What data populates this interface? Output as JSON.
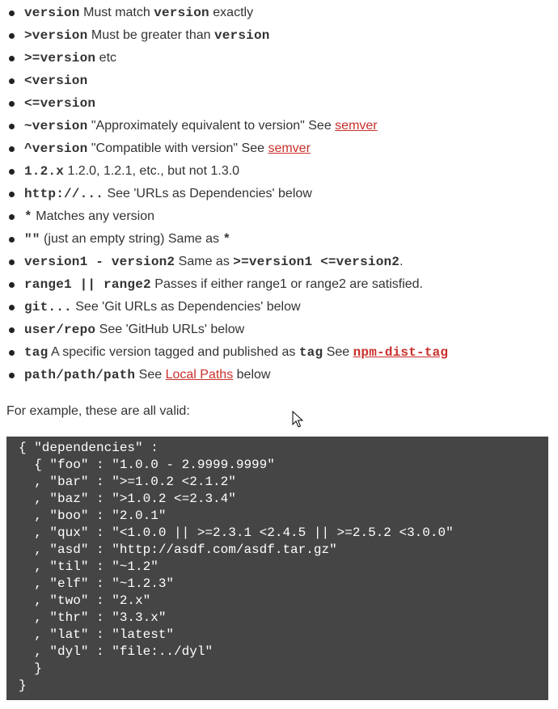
{
  "rules": [
    {
      "parts": [
        {
          "k": "code",
          "v": "version"
        },
        {
          "k": "text",
          "v": " Must match "
        },
        {
          "k": "code",
          "v": "version"
        },
        {
          "k": "text",
          "v": " exactly"
        }
      ]
    },
    {
      "parts": [
        {
          "k": "code",
          "v": ">version"
        },
        {
          "k": "text",
          "v": " Must be greater than "
        },
        {
          "k": "code",
          "v": "version"
        }
      ]
    },
    {
      "parts": [
        {
          "k": "code",
          "v": ">=version"
        },
        {
          "k": "text",
          "v": " etc"
        }
      ]
    },
    {
      "parts": [
        {
          "k": "code",
          "v": "<version"
        }
      ]
    },
    {
      "parts": [
        {
          "k": "code",
          "v": "<=version"
        }
      ]
    },
    {
      "parts": [
        {
          "k": "code",
          "v": "~version"
        },
        {
          "k": "text",
          "v": " \"Approximately equivalent to version\" See "
        },
        {
          "k": "link",
          "v": "semver"
        }
      ]
    },
    {
      "parts": [
        {
          "k": "code",
          "v": "^version"
        },
        {
          "k": "text",
          "v": " \"Compatible with version\" See "
        },
        {
          "k": "link",
          "v": "semver"
        }
      ]
    },
    {
      "parts": [
        {
          "k": "code",
          "v": "1.2.x"
        },
        {
          "k": "text",
          "v": " 1.2.0, 1.2.1, etc., but not 1.3.0"
        }
      ]
    },
    {
      "parts": [
        {
          "k": "code",
          "v": "http://..."
        },
        {
          "k": "text",
          "v": " See 'URLs as Dependencies' below"
        }
      ]
    },
    {
      "parts": [
        {
          "k": "code",
          "v": "*"
        },
        {
          "k": "text",
          "v": " Matches any version"
        }
      ]
    },
    {
      "parts": [
        {
          "k": "code",
          "v": "\"\""
        },
        {
          "k": "text",
          "v": " (just an empty string) Same as "
        },
        {
          "k": "code",
          "v": "*"
        }
      ]
    },
    {
      "parts": [
        {
          "k": "code",
          "v": "version1 - version2"
        },
        {
          "k": "text",
          "v": " Same as "
        },
        {
          "k": "code",
          "v": ">=version1 <=version2"
        },
        {
          "k": "text",
          "v": "."
        }
      ]
    },
    {
      "parts": [
        {
          "k": "code",
          "v": "range1 || range2"
        },
        {
          "k": "text",
          "v": " Passes if either range1 or range2 are satisfied."
        }
      ]
    },
    {
      "parts": [
        {
          "k": "code",
          "v": "git..."
        },
        {
          "k": "text",
          "v": " See 'Git URLs as Dependencies' below"
        }
      ]
    },
    {
      "parts": [
        {
          "k": "code",
          "v": "user/repo"
        },
        {
          "k": "text",
          "v": " See 'GitHub URLs' below"
        }
      ]
    },
    {
      "parts": [
        {
          "k": "code",
          "v": "tag"
        },
        {
          "k": "text",
          "v": " A specific version tagged and published as "
        },
        {
          "k": "code",
          "v": "tag"
        },
        {
          "k": "text",
          "v": " See "
        },
        {
          "k": "linkcode",
          "v": "npm-dist-tag"
        }
      ]
    },
    {
      "parts": [
        {
          "k": "code",
          "v": "path/path/path"
        },
        {
          "k": "text",
          "v": " See "
        },
        {
          "k": "link",
          "v": "Local Paths"
        },
        {
          "k": "text",
          "v": " below"
        }
      ]
    }
  ],
  "example_intro": "For example, these are all valid:",
  "code_lines": [
    "{ \"dependencies\" :",
    "  { \"foo\" : \"1.0.0 - 2.9999.9999\"",
    "  , \"bar\" : \">=1.0.2 <2.1.2\"",
    "  , \"baz\" : \">1.0.2 <=2.3.4\"",
    "  , \"boo\" : \"2.0.1\"",
    "  , \"qux\" : \"<1.0.0 || >=2.3.1 <2.4.5 || >=2.5.2 <3.0.0\"",
    "  , \"asd\" : \"http://asdf.com/asdf.tar.gz\"",
    "  , \"til\" : \"~1.2\"",
    "  , \"elf\" : \"~1.2.3\"",
    "  , \"two\" : \"2.x\"",
    "  , \"thr\" : \"3.3.x\"",
    "  , \"lat\" : \"latest\"",
    "  , \"dyl\" : \"file:../dyl\"",
    "  }",
    "}"
  ],
  "colors": {
    "link": "#c9302c",
    "code_bg": "#454545",
    "text": "#333333"
  }
}
